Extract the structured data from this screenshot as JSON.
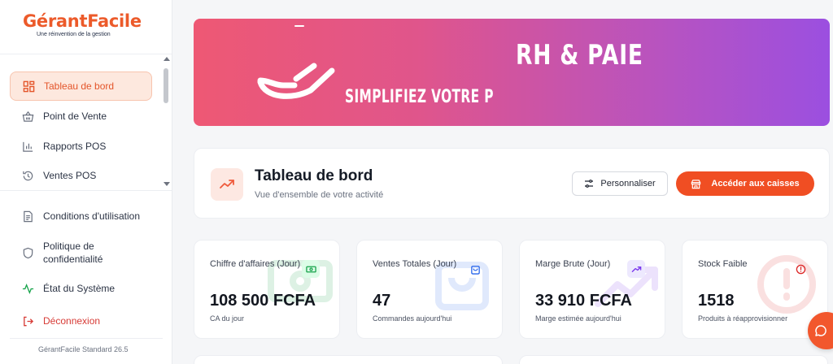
{
  "brand": {
    "name": "GérantFacile",
    "tagline": "Une réinvention de la gestion"
  },
  "sidebar": {
    "items": [
      {
        "label": "Tableau de bord",
        "icon": "dashboard-icon",
        "active": true
      },
      {
        "label": "Point de Vente",
        "icon": "basket-icon"
      },
      {
        "label": "Rapports POS",
        "icon": "bar-chart-icon"
      },
      {
        "label": "Ventes POS",
        "icon": "history-icon"
      }
    ],
    "bottom_items": [
      {
        "label": "Conditions d'utilisation",
        "icon": "document-icon"
      },
      {
        "label": "Politique de confidentialité",
        "icon": "shield-icon"
      },
      {
        "label": "État du Système",
        "icon": "activity-icon"
      },
      {
        "label": "Déconnexion",
        "icon": "logout-icon"
      }
    ],
    "version": "GérantFacile Standard 26.5"
  },
  "banner": {
    "title": "RH & PAIE",
    "subtitle": "SIMPLIFIEZ VOTRE P"
  },
  "header": {
    "title": "Tableau de bord",
    "subtitle": "Vue d'ensemble de votre activité",
    "customize_label": "Personnaliser",
    "cashier_label": "Accéder aux caisses"
  },
  "stats": [
    {
      "label": "Chiffre d'affaires (Jour)",
      "value": "108 500 FCFA",
      "note": "CA du jour",
      "icon": "cash-icon",
      "color": "#16a34a",
      "tint": "#dcfce7"
    },
    {
      "label": "Ventes Totales (Jour)",
      "value": "47",
      "note": "Commandes aujourd'hui",
      "icon": "shopping-bag-icon",
      "color": "#2563eb",
      "tint": "#dbeafe"
    },
    {
      "label": "Marge Brute (Jour)",
      "value": "33 910 FCFA",
      "note": "Marge estimée aujourd'hui",
      "icon": "trending-up-icon",
      "color": "#7c3aed",
      "tint": "#ede9fe"
    },
    {
      "label": "Stock Faible",
      "value": "1518",
      "note": "Produits à réapprovisionner",
      "icon": "alert-circle-icon",
      "color": "#dc2626",
      "tint": "#fee2e2"
    }
  ],
  "colors": {
    "accent": "#f04e23",
    "active_bg": "#fde8de"
  }
}
